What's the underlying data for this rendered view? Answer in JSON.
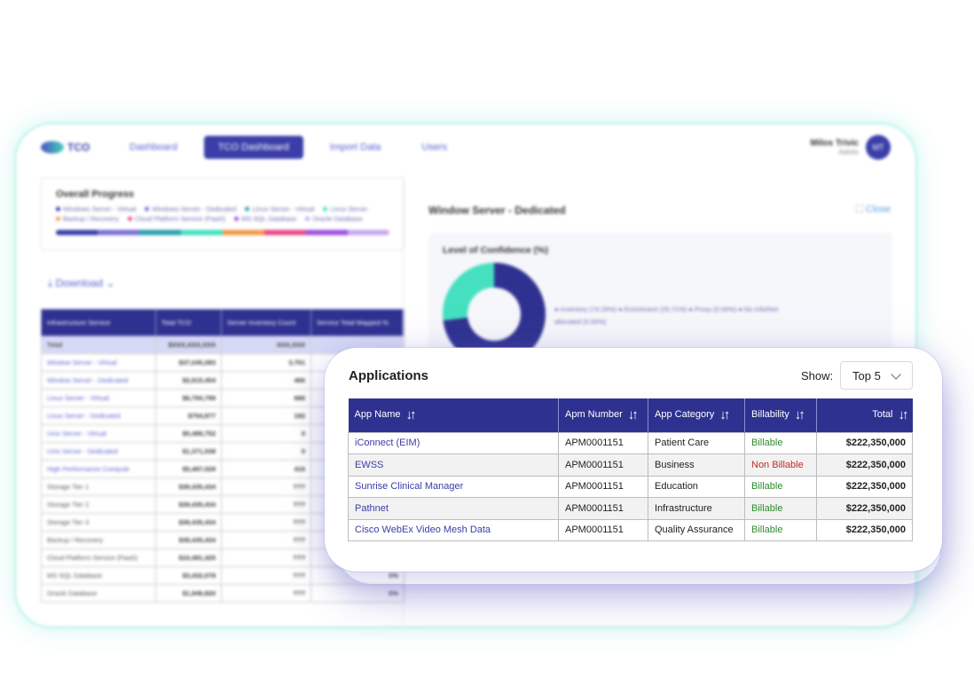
{
  "nav": {
    "logo_text": "TCO",
    "items": [
      "Dashboard",
      "TCO Dashboard",
      "Import Data",
      "Users"
    ],
    "active_index": 1,
    "user": {
      "name": "Milos Trivic",
      "role": "Admin",
      "initials": "MT"
    }
  },
  "progress": {
    "title": "Overall Progress",
    "legend": [
      {
        "label": "Windows Server - Virtual",
        "color": "#3b3ea8"
      },
      {
        "label": "Windows Server - Dedicated",
        "color": "#7a6fd8"
      },
      {
        "label": "Linux Server - Virtual",
        "color": "#2a9fb0"
      },
      {
        "label": "Linux Server",
        "color": "#45e0c0"
      },
      {
        "label": "Backup / Recovery",
        "color": "#f2994a"
      },
      {
        "label": "Cloud Platform Service (PaaS)",
        "color": "#e84a8a"
      },
      {
        "label": "MS SQL Database",
        "color": "#9b51e0"
      },
      {
        "label": "Oracle Database",
        "color": "#c9a8f0"
      }
    ]
  },
  "download_label": "Download",
  "infra_table": {
    "headers": [
      "Infrastructure Service",
      "Total TCO",
      "Server Inventory Count",
      "Service Total Mapped %"
    ],
    "total_row": [
      "Total",
      "$XXX,XXX,XXX",
      "XXX,XXX",
      ""
    ],
    "rows": [
      [
        "Window Server - Virtual",
        "$37,045,083",
        "3,751",
        ""
      ],
      [
        "Window Server - Dedicated",
        "$2,815,454",
        "466",
        ""
      ],
      [
        "Linux Server - Virtual",
        "$6,794,799",
        "686",
        ""
      ],
      [
        "Linux Server - Dedicated",
        "$754,877",
        "182",
        ""
      ],
      [
        "Unix Server - Virtual",
        "$5,489,752",
        "0",
        ""
      ],
      [
        "Unix Server - Dedicated",
        "$1,371,538",
        "0",
        ""
      ],
      [
        "High Performance Compute",
        "$5,487,029",
        "416",
        ""
      ],
      [
        "Storage Tier 1",
        "$39,435,434",
        "???",
        ""
      ],
      [
        "Storage Tier 2",
        "$39,435,434",
        "???",
        ""
      ],
      [
        "Storage Tier 3",
        "$39,435,434",
        "???",
        ""
      ],
      [
        "Backup / Recovery",
        "$39,435,434",
        "???",
        ""
      ],
      [
        "Cloud Platform Service (PaaS)",
        "$10,481,425",
        "???",
        ""
      ],
      [
        "MS SQL Database",
        "$3,432,078",
        "???",
        "0%"
      ],
      [
        "Oracle Database",
        "$1,946,820",
        "???",
        "0%"
      ]
    ]
  },
  "detail": {
    "title": "Window Server - Dedicated",
    "close_label": "Close",
    "confidence_title": "Level of Confidence (%)",
    "confidence_legend": "● Inventory (74.29%)  ● Enrichment (25.71%)  ● Proxy (0.00%)  ● No Info/Not allocated (0.00%)",
    "confidence_values": {
      "inventory": 74.29,
      "enrichment": 25.71,
      "proxy": 0.0,
      "none": 0.0
    }
  },
  "applications": {
    "title": "Applications",
    "show_label": "Show:",
    "show_value": "Top 5",
    "headers": [
      "App Name",
      "Apm Number",
      "App Category",
      "Billability",
      "Total"
    ],
    "rows": [
      {
        "name": "iConnect (EIM)",
        "apm": "APM0001151",
        "category": "Patient Care",
        "billability": "Billable",
        "total": "$222,350,000"
      },
      {
        "name": "EWSS",
        "apm": "APM0001151",
        "category": "Business",
        "billability": "Non Billable",
        "total": "$222,350,000"
      },
      {
        "name": "Sunrise Clinical Manager",
        "apm": "APM0001151",
        "category": "Education",
        "billability": "Billable",
        "total": "$222,350,000"
      },
      {
        "name": "Pathnet",
        "apm": "APM0001151",
        "category": "Infrastructure",
        "billability": "Billable",
        "total": "$222,350,000"
      },
      {
        "name": "Cisco WebEx Video Mesh Data",
        "apm": "APM0001151",
        "category": "Quality Assurance",
        "billability": "Billable",
        "total": "$222,350,000"
      }
    ],
    "colors": {
      "header": "#2f3190",
      "link": "#3a3da6",
      "billable": "#2e8b2e",
      "non_billable": "#c62828"
    }
  }
}
